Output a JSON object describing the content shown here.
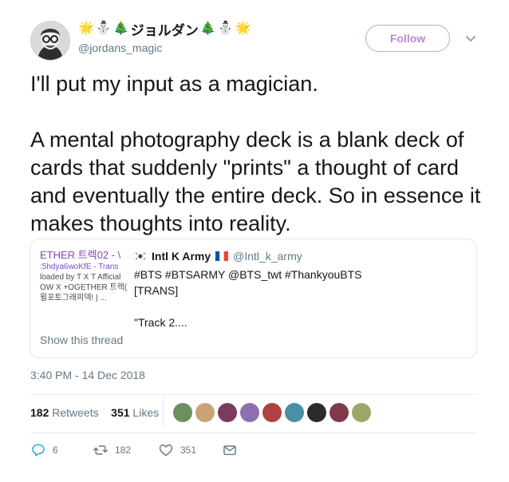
{
  "author": {
    "display_name_prefix_emojis": [
      "🌟",
      "⛄",
      "🎄"
    ],
    "display_name": "ジョルダン",
    "display_name_suffix_emojis": [
      "🎄",
      "⛄",
      "🌟"
    ],
    "handle": "@jordans_magic",
    "avatar_icon": "magician-avatar-icon"
  },
  "follow_label": "Follow",
  "tweet_text": "I'll put my input as a magician.\n\nA mental photography deck is a blank deck of cards that suddenly \"prints\" a thought of card and eventually the entire deck. So in essence it makes thoughts into reality.",
  "quote": {
    "thumbnail_lines": [
      "ETHER 트렉02 - \\",
      ":5hdya6woKfE - Trans",
      "loaded by T X T Afficial",
      "OW X +OGETHER 트렉(",
      "뮐포토그래피덱! | ..."
    ],
    "name_prefix_flag": "south-korea-flag",
    "name": "Intl K Army",
    "name_suffix_flag": "france-flag",
    "handle": "@Intl_k_army",
    "body_lines": [
      "#BTS #BTSARMY @BTS_twt #ThankyouBTS",
      "[TRANS]",
      "",
      "\"Track 2...."
    ],
    "show_thread": "Show this thread"
  },
  "timestamp": "3:40 PM - 14 Dec 2018",
  "stats": {
    "retweets_count": "182",
    "retweets_label": "Retweets",
    "likes_count": "351",
    "likes_label": "Likes"
  },
  "likers_colors": [
    "#6b8f5e",
    "#c9a27a",
    "#7a3b5e",
    "#8b6fb0",
    "#b0413e",
    "#4a8fa8",
    "#2b2b2b",
    "#7d3b4a",
    "#9aa86a"
  ],
  "actions": {
    "reply_count": "6",
    "retweet_count": "182",
    "like_count": "351"
  },
  "colors": {
    "follow_border": "#c6a3d6",
    "follow_text": "#b888cf",
    "muted": "#657786",
    "divider": "#e6ecf0"
  }
}
